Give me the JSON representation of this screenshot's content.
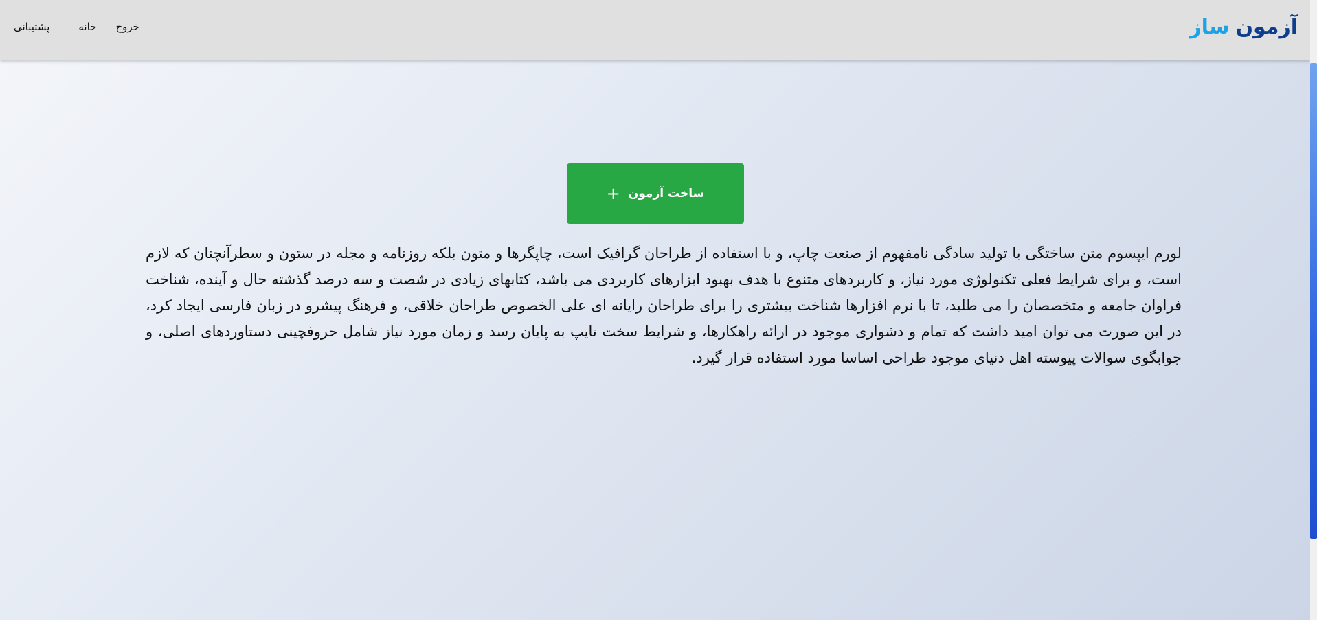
{
  "header": {
    "brand": {
      "part_a": "آزمون",
      "part_b": "ساز"
    },
    "nav": {
      "exit": "خروج",
      "home": "خانه",
      "support": "پشتیبانی"
    }
  },
  "main": {
    "create_button": {
      "label": "ساخت آزمون",
      "icon": "plus-icon"
    },
    "intro_text": "لورم ایپسوم متن ساختگی با تولید سادگی نامفهوم از صنعت چاپ، و با استفاده از طراحان گرافیک است، چاپگرها و متون بلکه روزنامه و مجله در ستون و سطرآنچنان که لازم است، و برای شرایط فعلی تکنولوژی مورد نیاز، و کاربردهای متنوع با هدف بهبود ابزارهای کاربردی می باشد، کتابهای زیادی در شصت و سه درصد گذشته حال و آینده، شناخت فراوان جامعه و متخصصان را می طلبد، تا با نرم افزارها شناخت بیشتری را برای طراحان رایانه ای علی الخصوص طراحان خلاقی، و فرهنگ پیشرو در زبان فارسی ایجاد کرد، در این صورت می توان امید داشت که تمام و دشواری موجود در ارائه راهکارها، و شرایط سخت تایپ به پایان رسد و زمان مورد نیاز شامل حروفچینی دستاوردهای اصلی، و جوابگوی سوالات پیوسته اهل دنیای موجود طراحی اساسا مورد استفاده قرار گیرد."
  },
  "colors": {
    "brand_dark": "#0d3d8c",
    "brand_light": "#1aa3e8",
    "button_green": "#27a844",
    "navbar_bg": "#e0e0e0"
  }
}
